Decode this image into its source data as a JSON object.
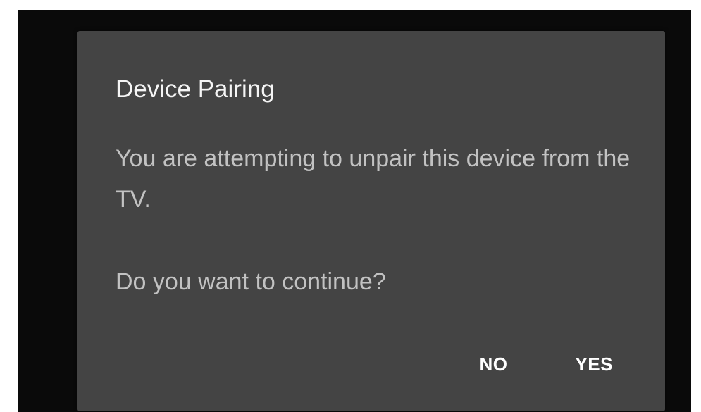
{
  "dialog": {
    "title": "Device Pairing",
    "message": "You are attempting to unpair this device from the TV.",
    "question": "Do you want to continue?",
    "buttons": {
      "no_label": "NO",
      "yes_label": "YES"
    }
  },
  "colors": {
    "backdrop": "#0a0a0a",
    "dialog_background": "#444444",
    "title_text": "#f5f5f5",
    "body_text": "#c2c2c2",
    "button_text": "#ffffff"
  }
}
